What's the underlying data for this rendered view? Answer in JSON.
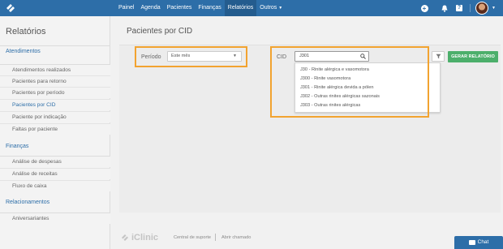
{
  "nav": {
    "items": [
      {
        "label": "Painel"
      },
      {
        "label": "Agenda"
      },
      {
        "label": "Pacientes"
      },
      {
        "label": "Finanças"
      },
      {
        "label": "Relatórios",
        "active": true
      },
      {
        "label": "Outros",
        "has_caret": true
      }
    ]
  },
  "sidebar": {
    "title": "Relatórios",
    "sections": [
      {
        "label": "Atendimentos",
        "items": [
          "Atendimentos realizados",
          "Pacientes para retorno",
          "Pacientes por período",
          "Pacientes por CID",
          "Paciente por indicação",
          "Faltas por paciente"
        ]
      },
      {
        "label": "Finanças",
        "items": [
          "Análise de despesas",
          "Análise de receitas",
          "Fluxo de caixa"
        ]
      },
      {
        "label": "Relacionamentos",
        "items": [
          "Aniversariantes"
        ]
      }
    ],
    "active_item": "Pacientes por CID"
  },
  "main": {
    "page_title": "Pacientes por CID",
    "periodo_label": "Período",
    "periodo_value": "Este mês",
    "cid_label": "CID",
    "cid_value": "J301",
    "cid_suggestions": [
      "J30 - Rinite alérgica e vasomotora",
      "J300 - Rinite vasomotora",
      "J301 - Rinite alérgica devida a pólen",
      "J302 - Outras rinites alérgicas sazonais",
      "J303 - Outras rinites alérgicas"
    ],
    "generate_button": "GERAR RELATÓRIO"
  },
  "footer": {
    "brand": "iClinic",
    "support_link": "Central de suporte",
    "ticket_link": "Abrir chamado"
  },
  "chat": {
    "label": "Chat"
  },
  "colors": {
    "primary": "#2d6ea8",
    "highlight": "#f2a330",
    "success": "#4caf6b"
  }
}
